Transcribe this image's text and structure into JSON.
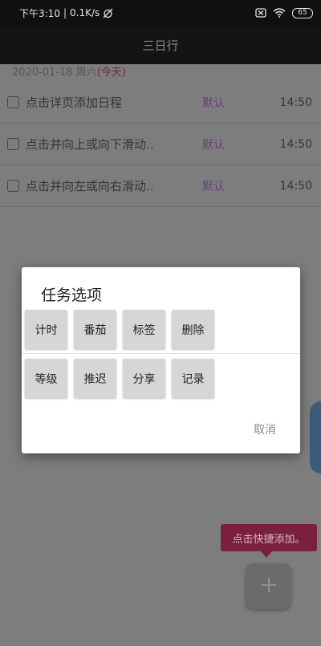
{
  "status_bar": {
    "time": "下午3:10",
    "separator": "|",
    "speed": "0.1K/s",
    "battery": "65"
  },
  "app_bar": {
    "title": "三日行"
  },
  "date_header": {
    "date": "2020-01-18 周六",
    "today_label": "(今天)"
  },
  "tasks": [
    {
      "title": "点击详页添加日程",
      "tag": "默认",
      "time": "14:50"
    },
    {
      "title": "点击并向上或向下滑动..",
      "tag": "默认",
      "time": "14:50"
    },
    {
      "title": "点击并向左或向右滑动..",
      "tag": "默认",
      "time": "14:50"
    }
  ],
  "dialog": {
    "title": "任务选项",
    "row1": [
      "计时",
      "番茄",
      "标签",
      "删除"
    ],
    "row2": [
      "等级",
      "推迟",
      "分享",
      "记录"
    ],
    "cancel": "取消"
  },
  "tooltip": {
    "text": "点击快捷添加。"
  },
  "colors": {
    "accent_tag": "#6a3d7a",
    "today": "#7a1f3a",
    "tooltip_bg": "#7a1f3c"
  },
  "icons": {
    "fab": "plus-icon",
    "status_left": "alarm-off-icon",
    "status_right": [
      "sim-icon",
      "wifi-icon",
      "battery-icon"
    ]
  }
}
